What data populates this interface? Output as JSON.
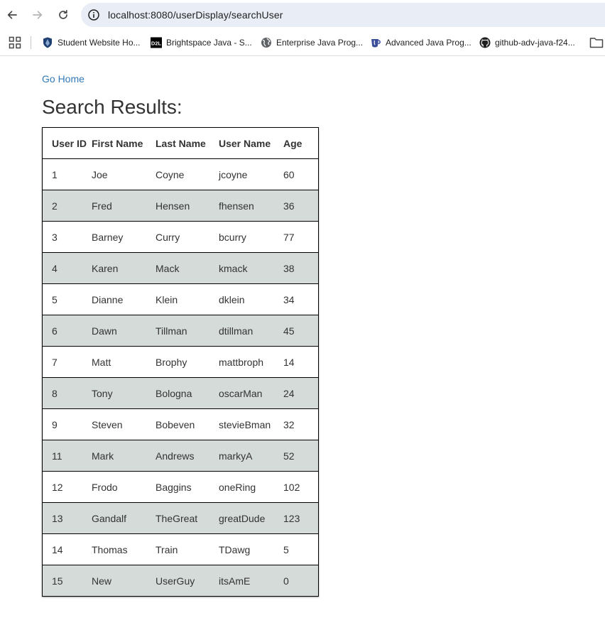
{
  "browser": {
    "url": "localhost:8080/userDisplay/searchUser",
    "bookmarks": [
      {
        "label": "Student Website Ho...",
        "icon": "shield-icon"
      },
      {
        "label": "Brightspace Java - S...",
        "icon": "d2l-icon"
      },
      {
        "label": "Enterprise Java Prog...",
        "icon": "globe-icon"
      },
      {
        "label": "Advanced Java Prog...",
        "icon": "coffee-icon"
      },
      {
        "label": "github-adv-java-f24...",
        "icon": "github-icon"
      }
    ]
  },
  "page": {
    "home_link": "Go Home",
    "title": "Search Results:"
  },
  "table": {
    "headers": [
      "User ID",
      "First Name",
      "Last Name",
      "User Name",
      "Age"
    ],
    "rows": [
      [
        "1",
        "Joe",
        "Coyne",
        "jcoyne",
        "60"
      ],
      [
        "2",
        "Fred",
        "Hensen",
        "fhensen",
        "36"
      ],
      [
        "3",
        "Barney",
        "Curry",
        "bcurry",
        "77"
      ],
      [
        "4",
        "Karen",
        "Mack",
        "kmack",
        "38"
      ],
      [
        "5",
        "Dianne",
        "Klein",
        "dklein",
        "34"
      ],
      [
        "6",
        "Dawn",
        "Tillman",
        "dtillman",
        "45"
      ],
      [
        "7",
        "Matt",
        "Brophy",
        "mattbroph",
        "14"
      ],
      [
        "8",
        "Tony",
        "Bologna",
        "oscarMan",
        "24"
      ],
      [
        "9",
        "Steven",
        "Bobeven",
        "stevieBman",
        "32"
      ],
      [
        "11",
        "Mark",
        "Andrews",
        "markyA",
        "52"
      ],
      [
        "12",
        "Frodo",
        "Baggins",
        "oneRing",
        "102"
      ],
      [
        "13",
        "Gandalf",
        "TheGreat",
        "greatDude",
        "123"
      ],
      [
        "14",
        "Thomas",
        "Train",
        "TDawg",
        "5"
      ],
      [
        "15",
        "New",
        "UserGuy",
        "itsAmE",
        "0"
      ]
    ]
  },
  "colors": {
    "link": "#337ab7",
    "stripe": "#d5dbd9",
    "omnibox": "#e9eef6"
  }
}
